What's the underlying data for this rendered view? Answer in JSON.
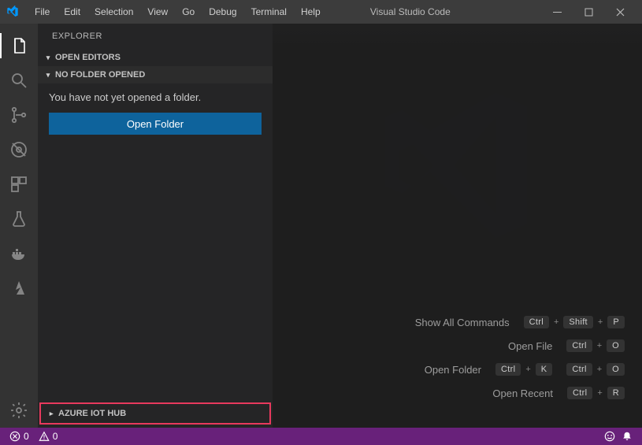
{
  "titlebar": {
    "menu": [
      "File",
      "Edit",
      "Selection",
      "View",
      "Go",
      "Debug",
      "Terminal",
      "Help"
    ],
    "title": "Visual Studio Code"
  },
  "sidebar": {
    "header": "EXPLORER",
    "sections": {
      "open_editors": "OPEN EDITORS",
      "no_folder": "NO FOLDER OPENED",
      "no_folder_msg": "You have not yet opened a folder.",
      "open_folder_btn": "Open Folder",
      "azure": "AZURE IOT HUB"
    }
  },
  "shortcuts": [
    {
      "label": "Show All Commands",
      "keys": [
        "Ctrl",
        "Shift",
        "P"
      ]
    },
    {
      "label": "Open File",
      "keys": [
        "Ctrl",
        "O"
      ]
    },
    {
      "label": "Open Folder",
      "keys": [
        "Ctrl",
        "K",
        "Ctrl",
        "O"
      ]
    },
    {
      "label": "Open Recent",
      "keys": [
        "Ctrl",
        "R"
      ]
    }
  ],
  "statusbar": {
    "errors": "0",
    "warnings": "0"
  },
  "icon_names": {
    "activity": [
      "files",
      "search",
      "git",
      "debug",
      "extensions",
      "beaker",
      "docker",
      "azure"
    ],
    "manage": "gear"
  }
}
